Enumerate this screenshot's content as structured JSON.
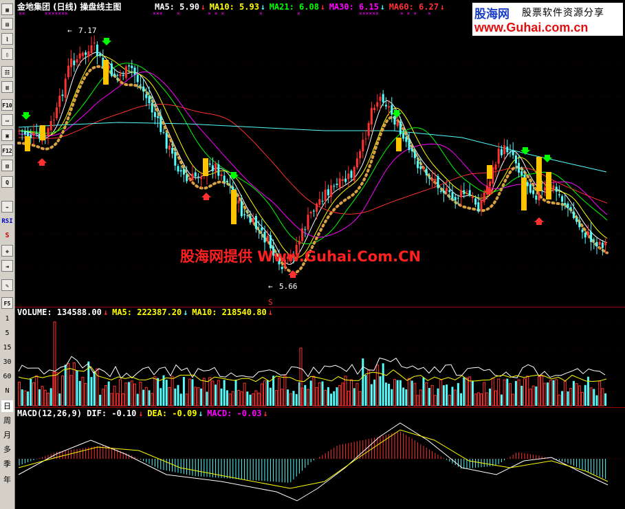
{
  "price_panel": {
    "title": "金地集团 (日线) 操盘线主图",
    "ma_items": [
      {
        "label": "MA5: 5.90",
        "color": "#ffffff"
      },
      {
        "label": "MA10: 5.93",
        "color": "#ffff00"
      },
      {
        "label": "MA21: 6.08",
        "color": "#00ff00"
      },
      {
        "label": "MA30: 6.15",
        "color": "#ff00ff"
      },
      {
        "label": "MA60: 6.27",
        "color": "#ff3030"
      }
    ],
    "high_marker": "7.17",
    "low_marker": "5.66"
  },
  "volume_panel": {
    "items": [
      {
        "label": "VOLUME: 134588.00",
        "color": "#ffffff"
      },
      {
        "label": "MA5: 222387.20",
        "color": "#ffff00"
      },
      {
        "label": "MA10: 218540.80",
        "color": "#ffff00"
      }
    ]
  },
  "macd_panel": {
    "items": [
      {
        "label": "MACD(12,26,9) DIF: -0.10",
        "color": "#ffffff"
      },
      {
        "label": "DEA: -0.09",
        "color": "#ffff00"
      },
      {
        "label": "MACD: -0.03",
        "color": "#ff00ff"
      }
    ]
  },
  "watermark": {
    "text": "股海网提供 Www.Guhai.Com.CN",
    "color": "#ff2020"
  },
  "logo": {
    "line1": "股海网",
    "line1b": "股票软件资源分享",
    "line2": "www.Guhai.com.cn"
  },
  "toolbar": {
    "buttons": [
      "▦",
      "▤",
      "⌇",
      "▯",
      "☷",
      "▥",
      "F10",
      "▭",
      "▣",
      "F12",
      "▧",
      "Q",
      "⌁",
      "RSI",
      "S",
      "✥",
      "⇥",
      "✎",
      "F5",
      "1",
      "5",
      "15",
      "30",
      "60",
      "N",
      "日",
      "周",
      "月",
      "多",
      "季",
      "年"
    ]
  },
  "colors": {
    "up": "#ff3232",
    "down": "#54fcfc",
    "ma5": "#ffffff",
    "ma10": "#ffff00",
    "ma21": "#00ff00",
    "ma30": "#ff00ff",
    "ma60": "#ff3030",
    "ma_long": "#54fcfc",
    "sar": "#d8a040"
  }
}
